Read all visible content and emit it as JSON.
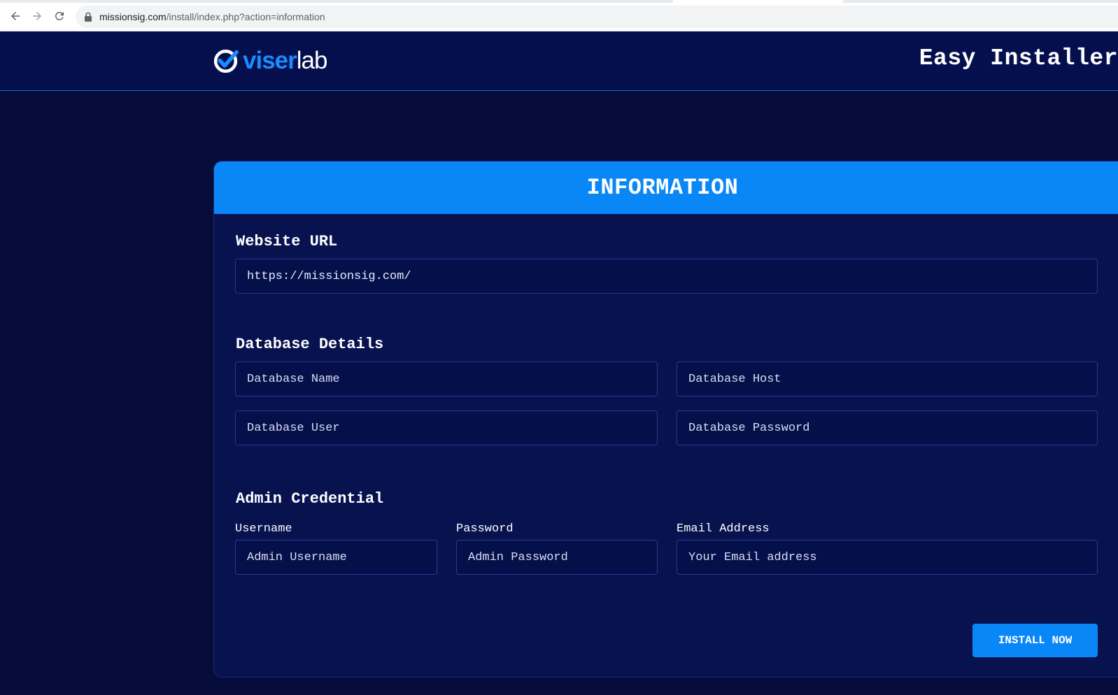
{
  "browser": {
    "url_host": "missionsig.com",
    "url_path": "/install/index.php?action=information"
  },
  "header": {
    "logo_accent": "viser",
    "logo_rest": "lab",
    "title": "Easy Installer"
  },
  "card": {
    "title": "INFORMATION",
    "website": {
      "heading": "Website URL",
      "value": "https://missionsig.com/"
    },
    "database": {
      "heading": "Database Details",
      "name_placeholder": "Database Name",
      "host_placeholder": "Database Host",
      "user_placeholder": "Database User",
      "password_placeholder": "Database Password"
    },
    "admin": {
      "heading": "Admin Credential",
      "username_label": "Username",
      "username_placeholder": "Admin Username",
      "password_label": "Password",
      "password_placeholder": "Admin Password",
      "email_label": "Email Address",
      "email_placeholder": "Your Email address"
    },
    "install_label": "INSTALL NOW"
  },
  "colors": {
    "page_bg": "#050c3a",
    "header_bg": "#050f4e",
    "card_bg": "#07124f",
    "accent": "#0a87f7"
  },
  "icons": [
    "back-arrow-icon",
    "forward-arrow-icon",
    "reload-icon",
    "lock-icon",
    "viserlab-check-logo-icon"
  ]
}
